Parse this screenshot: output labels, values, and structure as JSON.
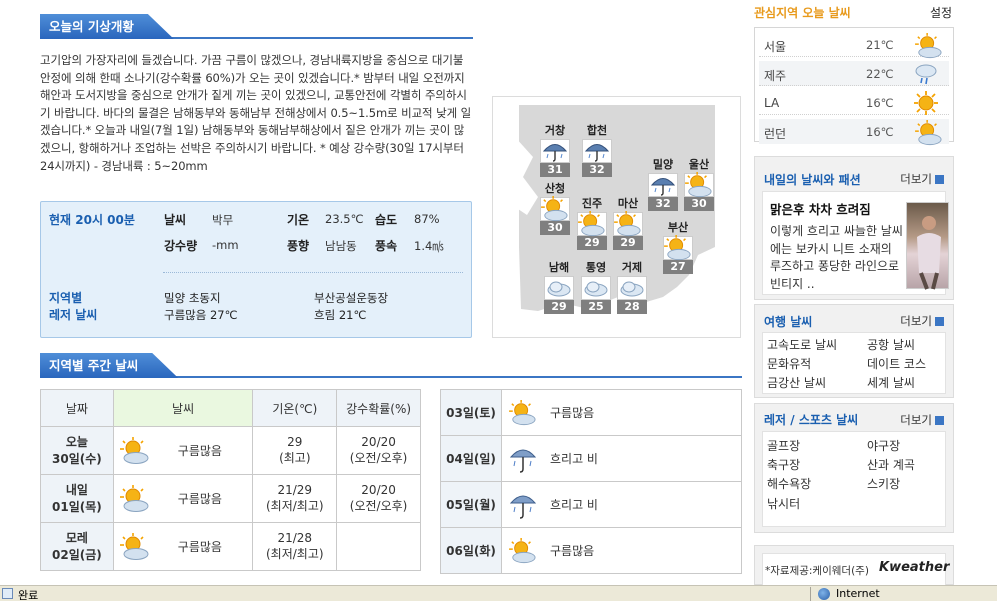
{
  "summary_section": {
    "title": "오늘의 기상개황",
    "text": "고기압의 가장자리에 들겠습니다. 가끔 구름이 많겠으나, 경남내륙지방을 중심으로 대기불안정에 의해 한때 소나기(강수확률 60%)가 오는 곳이 있겠습니다.* 밤부터 내일 오전까지 해안과 도서지방을 중심으로 안개가 짙게 끼는 곳이 있겠으니, 교통안전에 각별히 주의하시기 바랍니다. 바다의 물결은 남해동부와 동해남부 전해상에서 0.5~1.5m로 비교적 낮게 일겠습니다.* 오늘과 내일(7월 1일) 남해동부와 동해남부해상에서 짙은 안개가 끼는 곳이 많겠으니, 항해하거나 조업하는 선박은 주의하시기 바랍니다. * 예상 강수량(30일 17시부터 24시까지) - 경남내륙 : 5~20mm"
  },
  "current": {
    "time_label": "현재 20시 00분",
    "weather_k": "날씨",
    "weather_v": "박무",
    "temp_k": "기온",
    "temp_v": "23.5℃",
    "humid_k": "습도",
    "humid_v": "87%",
    "rain_k": "강수량",
    "rain_v": "-mm",
    "wind_dir_k": "풍향",
    "wind_dir_v": "남남동",
    "wind_spd_k": "풍속",
    "wind_spd_v": "1.4㎧",
    "leisure_label_1": "지역별",
    "leisure_label_2": "레저 날씨",
    "leisure": [
      {
        "place": "밀양 초동지",
        "cond": "구름많음 27℃"
      },
      {
        "place": "부산공설운동장",
        "cond": "흐림 21℃"
      }
    ]
  },
  "map": {
    "cities": [
      {
        "name": "거창",
        "temp": "31",
        "icon": "rain-icon"
      },
      {
        "name": "합천",
        "temp": "32",
        "icon": "rain-icon"
      },
      {
        "name": "밀양",
        "temp": "32",
        "icon": "rain-icon"
      },
      {
        "name": "울산",
        "temp": "30",
        "icon": "partly-cloudy-icon"
      },
      {
        "name": "산청",
        "temp": "30",
        "icon": "partly-cloudy-icon"
      },
      {
        "name": "진주",
        "temp": "29",
        "icon": "partly-cloudy-icon"
      },
      {
        "name": "마산",
        "temp": "29",
        "icon": "partly-cloudy-icon"
      },
      {
        "name": "부산",
        "temp": "27",
        "icon": "partly-cloudy-icon"
      },
      {
        "name": "남해",
        "temp": "29",
        "icon": "cloud-icon"
      },
      {
        "name": "통영",
        "temp": "25",
        "icon": "cloud-icon"
      },
      {
        "name": "거제",
        "temp": "28",
        "icon": "cloud-icon"
      }
    ]
  },
  "weekly": {
    "title": "지역별 주간 날씨",
    "headers": [
      "날짜",
      "날씨",
      "기온(℃)",
      "강수확률(%)"
    ],
    "rows": [
      {
        "d1": "오늘",
        "d2": "30일(수)",
        "weather": "구름많음",
        "t1": "29",
        "t2": "(최고)",
        "p1": "20/20",
        "p2": "(오전/오후)"
      },
      {
        "d1": "내일",
        "d2": "01일(목)",
        "weather": "구름많음",
        "t1": "21/29",
        "t2": "(최저/최고)",
        "p1": "20/20",
        "p2": "(오전/오후)"
      },
      {
        "d1": "모레",
        "d2": "02일(금)",
        "weather": "구름많음",
        "t1": "21/28",
        "t2": "(최저/최고)",
        "p1": "",
        "p2": ""
      }
    ],
    "later": [
      {
        "day": "03일(토)",
        "weather": "구름많음",
        "icon": "partly-cloudy-icon"
      },
      {
        "day": "04일(일)",
        "weather": "흐리고 비",
        "icon": "umbrella-icon"
      },
      {
        "day": "05일(월)",
        "weather": "흐리고 비",
        "icon": "umbrella-icon"
      },
      {
        "day": "06일(화)",
        "weather": "구름많음",
        "icon": "partly-cloudy-icon"
      }
    ]
  },
  "interest": {
    "title": "관심지역 오늘 날씨",
    "settings": "설정",
    "rows": [
      {
        "city": "서울",
        "temp": "21℃",
        "icon": "partly-cloudy-icon"
      },
      {
        "city": "제주",
        "temp": "22℃",
        "icon": "shower-icon"
      },
      {
        "city": "LA",
        "temp": "16℃",
        "icon": "sun-icon"
      },
      {
        "city": "런던",
        "temp": "16℃",
        "icon": "partly-cloudy-icon"
      }
    ]
  },
  "fashion": {
    "title": "내일의 날씨와 패션",
    "more": "더보기",
    "headline": "맑은후 차차 흐려짐",
    "body": "이렇게 흐리고 싸늘한 날씨에는 보카시 니트 소재의 루즈하고 퐁당한 라인으로 빈티지 .."
  },
  "travel": {
    "title": "여행 날씨",
    "more": "더보기",
    "links": [
      "고속도로 날씨",
      "공항 날씨",
      "문화유적",
      "데이트 코스",
      "금강산 날씨",
      "세계 날씨"
    ]
  },
  "leisure_sports": {
    "title": "레저 / 스포츠 날씨",
    "more": "더보기",
    "links": [
      "골프장",
      "야구장",
      "축구장",
      "산과 계곡",
      "해수욕장",
      "스키장",
      "낚시터"
    ]
  },
  "credit": {
    "text": "*자료제공:케이웨더(주)",
    "brand": "Kweather"
  },
  "status": {
    "left": "완료",
    "right": "Internet"
  },
  "colors": {
    "accent": "#3b76c4",
    "link_blue": "#1a5fb0",
    "header_orange": "#e89a1c"
  }
}
